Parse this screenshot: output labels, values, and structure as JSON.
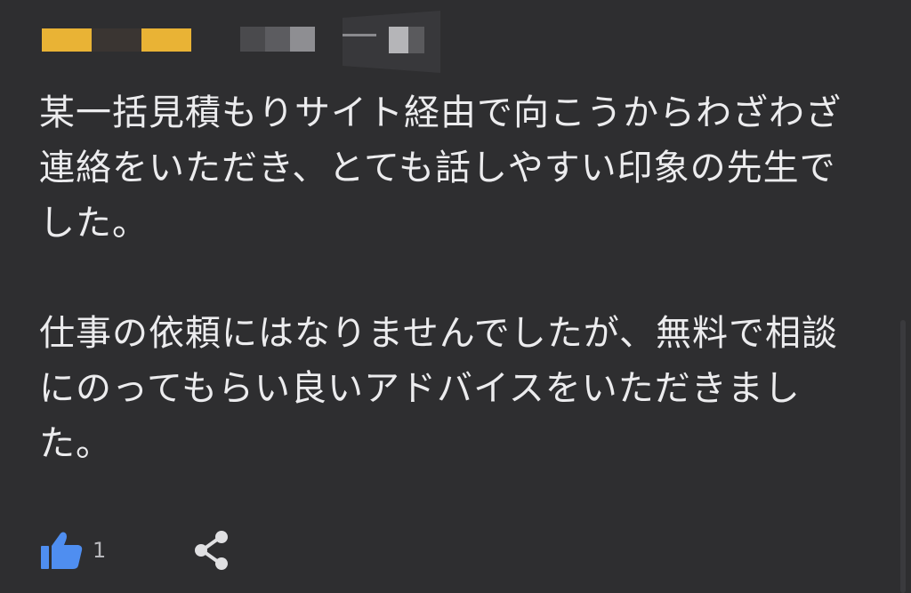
{
  "review": {
    "rating": {
      "stars_filled": 2,
      "stars_total": 3,
      "colors": {
        "filled": "#e9b335",
        "empty": "#3a3532"
      }
    },
    "paragraphs": [
      "某一括見積もりサイト経由で向こうからわざわざ連絡をいただき、とても話しやすい印象の先生でした。",
      "仕事の依頼にはなりませんでしたが、無料で相談にのってもらい良いアドバイスをいただきました。"
    ],
    "actions": {
      "like_icon": "thumbs-up-icon",
      "like_count": "1",
      "share_icon": "share-icon"
    }
  },
  "colors": {
    "background": "#2e2e30",
    "text": "#ececee",
    "accent": "#1a73e8"
  }
}
